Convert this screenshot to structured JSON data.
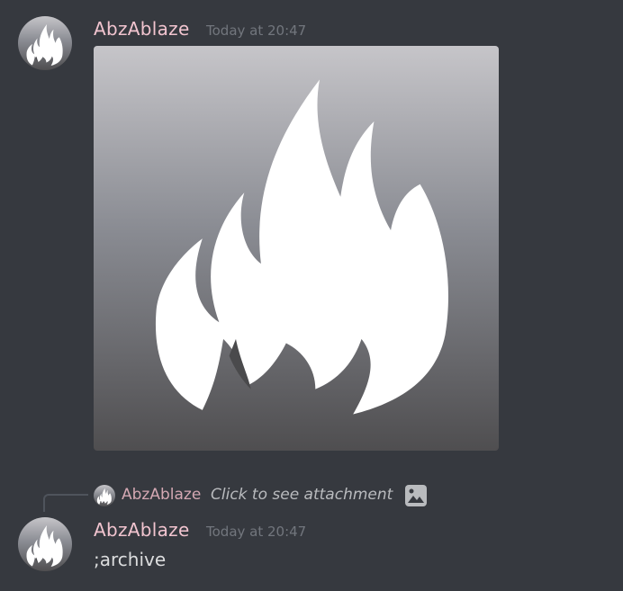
{
  "messages": [
    {
      "author": "AbzAblaze",
      "timestamp": "Today at 20:47",
      "attachment": {
        "type": "image",
        "icon": "flame-logo"
      }
    },
    {
      "reply": {
        "author": "AbzAblaze",
        "preview": "Click to see attachment",
        "icon": "image-icon"
      },
      "author": "AbzAblaze",
      "timestamp": "Today at 20:47",
      "content": ";archive"
    }
  ],
  "colors": {
    "background": "#36393f",
    "username": "#f1c4cf",
    "timestamp": "#72767d",
    "message_text": "#dcddde",
    "reply_preview": "#b9bbbe"
  }
}
